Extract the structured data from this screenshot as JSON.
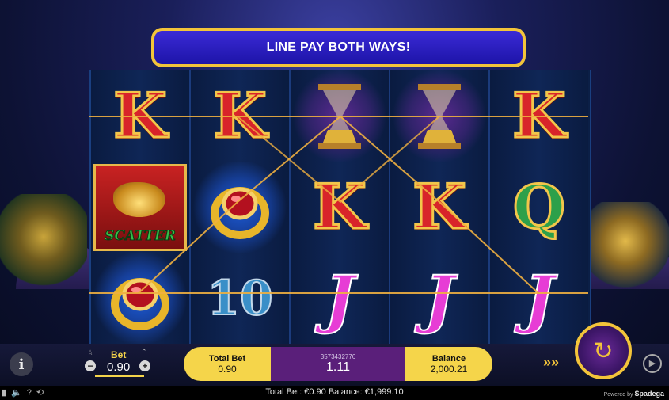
{
  "banner": {
    "text": "LINE PAY BOTH WAYS!"
  },
  "reels": [
    [
      {
        "symbol": "K",
        "name": "k"
      },
      {
        "symbol": "SCATTER",
        "name": "scatter"
      },
      {
        "symbol": "RING",
        "name": "ring"
      }
    ],
    [
      {
        "symbol": "K",
        "name": "k"
      },
      {
        "symbol": "RING",
        "name": "ring"
      },
      {
        "symbol": "10",
        "name": "ten"
      }
    ],
    [
      {
        "symbol": "HOURGLASS",
        "name": "hourglass"
      },
      {
        "symbol": "K",
        "name": "k"
      },
      {
        "symbol": "J",
        "name": "j"
      }
    ],
    [
      {
        "symbol": "HOURGLASS",
        "name": "hourglass"
      },
      {
        "symbol": "K",
        "name": "k"
      },
      {
        "symbol": "J",
        "name": "j"
      }
    ],
    [
      {
        "symbol": "K",
        "name": "k"
      },
      {
        "symbol": "Q",
        "name": "q"
      },
      {
        "symbol": "J",
        "name": "j"
      }
    ]
  ],
  "scatter_label": "SCATTER",
  "bet": {
    "label": "Bet",
    "value": "0.90"
  },
  "total_bet": {
    "label": "Total Bet",
    "value": "0.90"
  },
  "win": {
    "round_id": "3573432776",
    "value": "1.11"
  },
  "balance": {
    "label": "Balance",
    "value": "2,000.21"
  },
  "footer": {
    "summary": "Total Bet: €0.90  Balance: €1,999.10",
    "powered_by": "Powered by",
    "brand": "Spadega"
  },
  "colors": {
    "accent": "#f3c43a",
    "panel_yellow": "#f5d54a",
    "panel_purple": "#5a1f7a",
    "banner_blue": "#2a1fc0"
  },
  "icons": [
    "info-icon",
    "minus-icon",
    "plus-icon",
    "turbo-icon",
    "spin-icon",
    "autoplay-icon",
    "sound-icon",
    "help-icon",
    "history-icon"
  ]
}
